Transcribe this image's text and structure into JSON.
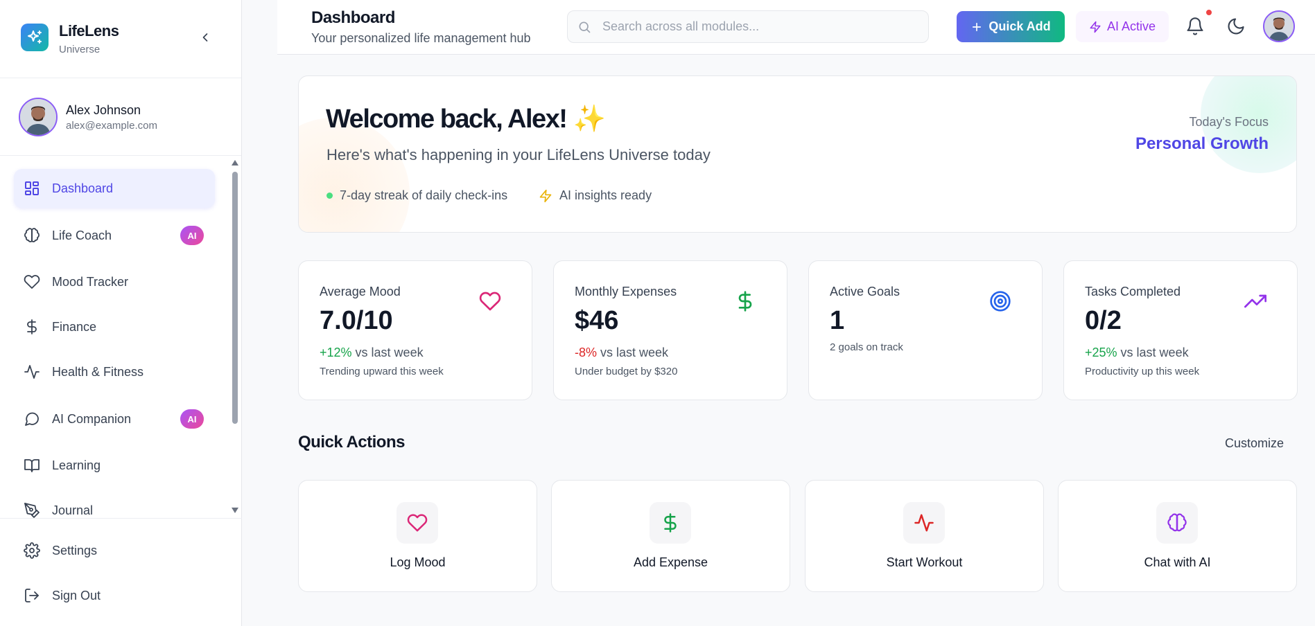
{
  "brand": {
    "name": "LifeLens",
    "sub": "Universe"
  },
  "user": {
    "name": "Alex Johnson",
    "email": "alex@example.com"
  },
  "nav": {
    "items": [
      {
        "label": "Dashboard",
        "icon": "dashboard-icon",
        "active": true
      },
      {
        "label": "Life Coach",
        "icon": "brain-icon",
        "badge": "AI"
      },
      {
        "label": "Mood Tracker",
        "icon": "heart-icon"
      },
      {
        "label": "Finance",
        "icon": "dollar-icon"
      },
      {
        "label": "Health & Fitness",
        "icon": "activity-icon"
      },
      {
        "label": "AI Companion",
        "icon": "chat-icon",
        "badge": "AI"
      },
      {
        "label": "Learning",
        "icon": "book-icon"
      },
      {
        "label": "Journal",
        "icon": "pen-icon"
      }
    ],
    "bottom": [
      {
        "label": "Settings",
        "icon": "gear-icon"
      },
      {
        "label": "Sign Out",
        "icon": "sign-out-icon"
      }
    ]
  },
  "header": {
    "title": "Dashboard",
    "subtitle": "Your personalized life management hub",
    "search_placeholder": "Search across all modules...",
    "quick_add": "Quick Add",
    "ai_active": "AI Active"
  },
  "welcome": {
    "title": "Welcome back, Alex! ✨",
    "subtitle": "Here's what's happening in your LifeLens Universe today",
    "streak": "7-day streak of daily check-ins",
    "insights": "AI insights ready",
    "focus_label": "Today's Focus",
    "focus_value": "Personal Growth"
  },
  "stats": [
    {
      "title": "Average Mood",
      "value": "7.0/10",
      "change": "+12%",
      "change_suffix": " vs last week",
      "note": "Trending upward this week",
      "icon": "heart-icon",
      "color": "#db2777"
    },
    {
      "title": "Monthly Expenses",
      "value": "$46",
      "change": "-8%",
      "change_suffix": " vs last week",
      "note": "Under budget by $320",
      "icon": "dollar-icon",
      "color": "#16a34a"
    },
    {
      "title": "Active Goals",
      "value": "1",
      "note": "2 goals on track",
      "icon": "target-icon",
      "color": "#2563eb"
    },
    {
      "title": "Tasks Completed",
      "value": "0/2",
      "change": "+25%",
      "change_suffix": " vs last week",
      "note": "Productivity up this week",
      "icon": "trending-up-icon",
      "color": "#9333ea"
    }
  ],
  "quick_actions": {
    "title": "Quick Actions",
    "customize": "Customize",
    "items": [
      {
        "label": "Log Mood",
        "icon": "heart-icon",
        "color": "#db2777"
      },
      {
        "label": "Add Expense",
        "icon": "dollar-icon",
        "color": "#16a34a"
      },
      {
        "label": "Start Workout",
        "icon": "activity-icon",
        "color": "#dc2626"
      },
      {
        "label": "Chat with AI",
        "icon": "brain-icon",
        "color": "#9333ea"
      }
    ]
  }
}
